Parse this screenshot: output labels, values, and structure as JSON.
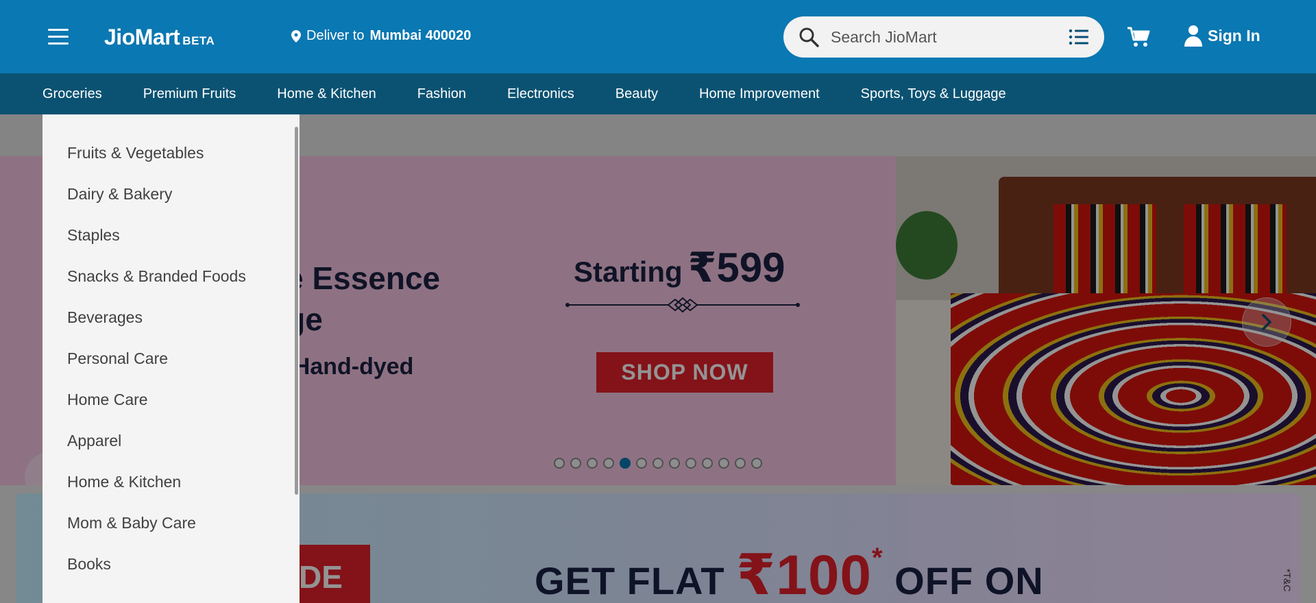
{
  "header": {
    "logo": "JioMart",
    "logo_badge": "BETA",
    "deliver_label": "Deliver to",
    "deliver_location": "Mumbai 400020",
    "search_placeholder": "Search JioMart",
    "signin_label": "Sign In",
    "brand_color": "#0a78b2"
  },
  "nav": {
    "active": "Groceries",
    "items": [
      "Groceries",
      "Premium Fruits",
      "Home & Kitchen",
      "Fashion",
      "Electronics",
      "Beauty",
      "Home Improvement",
      "Sports, Toys & Luggage"
    ]
  },
  "dropdown": {
    "items": [
      "Fruits & Vegetables",
      "Dairy & Bakery",
      "Staples",
      "Snacks & Branded Foods",
      "Beverages",
      "Personal Care",
      "Home Care",
      "Apparel",
      "Home & Kitchen",
      "Mom & Baby Care",
      "Books"
    ]
  },
  "banner": {
    "headline_line1": "n The Essence",
    "headline_line2": "eritage",
    "subline": "nade | Hand-dyed",
    "price_label": "Starting",
    "price": "₹599",
    "cta": "SHOP NOW",
    "slide_count": 13,
    "active_slide": 5
  },
  "promo": {
    "tag": "DE",
    "headline_prefix": "GET FLAT",
    "amount": "₹100",
    "amount_mark": "*",
    "headline_suffix": "OFF ON",
    "tc": "*T&C"
  },
  "icons": {
    "menu": "hamburger-icon",
    "location": "location-pin-icon",
    "search": "search-icon",
    "list": "list-icon",
    "cart": "cart-icon",
    "user": "user-icon",
    "next": "chevron-right-icon"
  }
}
